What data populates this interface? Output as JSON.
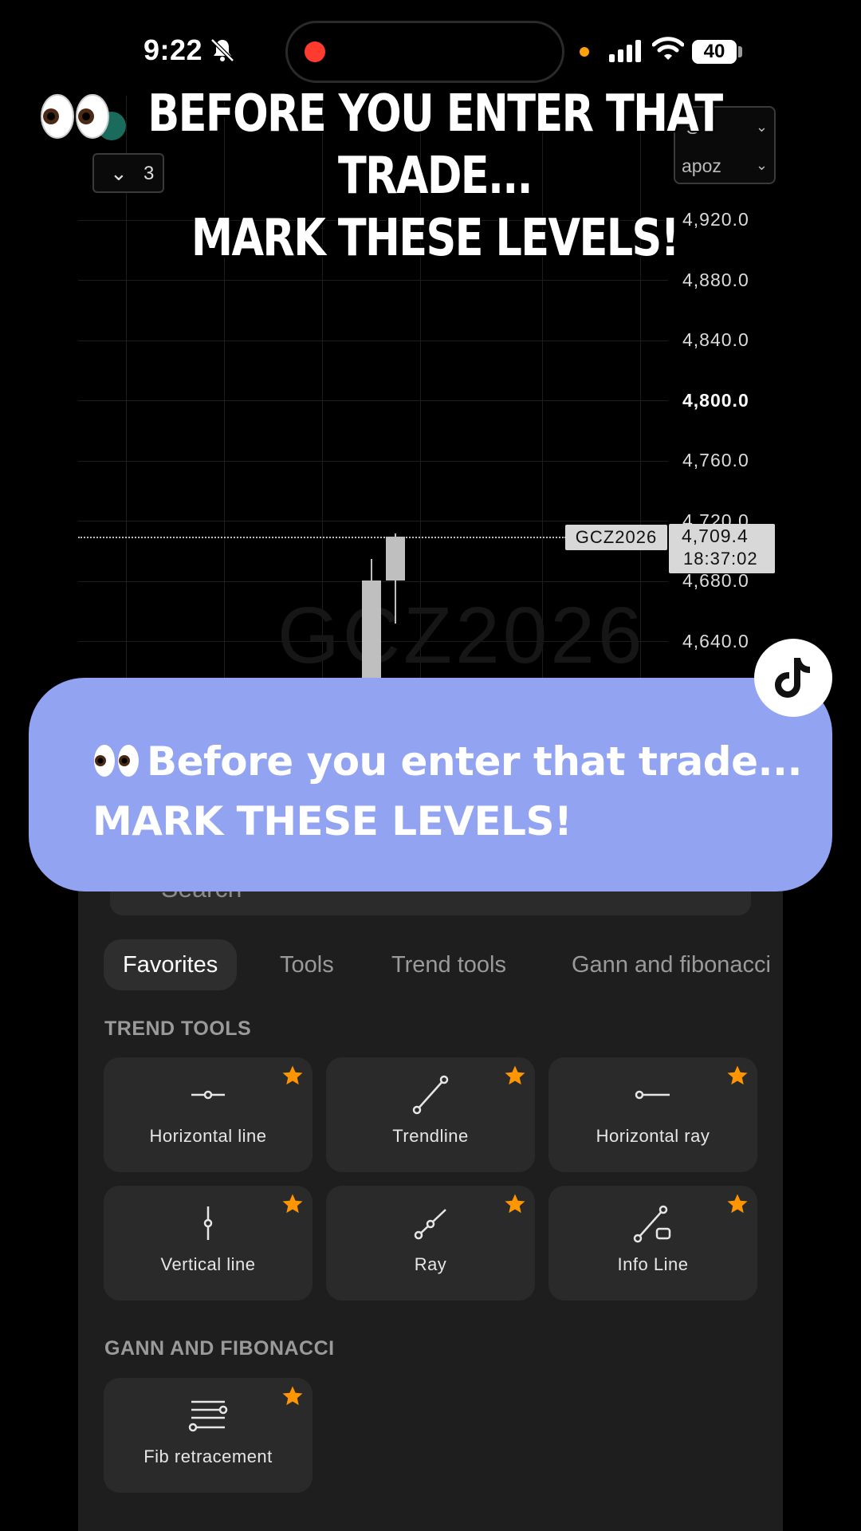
{
  "status_bar": {
    "time": "9:22",
    "battery": "40"
  },
  "overlay": {
    "line1": "BEFORE YOU ENTER THAT TRADE...",
    "line2": "MARK THESE LEVELS!"
  },
  "chart": {
    "collapse_count": "3",
    "dropdown_top": "S",
    "dropdown_bottom": "apoz",
    "symbol": "GCZ2026",
    "watermark": "GCZ2026",
    "last_price": "4,709.4",
    "countdown": "18:37:02",
    "y_ticks": [
      "4,920.0",
      "4,880.0",
      "4,840.0",
      "4,800.0",
      "4,760.0",
      "4,720.0",
      "4,680.0",
      "4,640.0"
    ]
  },
  "chart_data": {
    "type": "candlestick",
    "symbol": "GCZ2026",
    "ylim": [
      4620,
      4940
    ],
    "y_ticks": [
      4920,
      4880,
      4840,
      4800,
      4760,
      4720,
      4680,
      4640
    ],
    "last_price": 4709.4,
    "candles": [
      {
        "open": 4612,
        "high": 4695,
        "low": 4600,
        "close": 4681
      },
      {
        "open": 4681,
        "high": 4712,
        "low": 4652,
        "close": 4710
      }
    ]
  },
  "sheet": {
    "search_placeholder": "Search",
    "tabs": [
      "Favorites",
      "Tools",
      "Trend tools",
      "Gann and fibonacci"
    ],
    "sections": [
      {
        "title": "TREND TOOLS",
        "tools": [
          "Horizontal line",
          "Trendline",
          "Horizontal ray",
          "Vertical line",
          "Ray",
          "Info Line"
        ]
      },
      {
        "title": "GANN AND FIBONACCI",
        "tools": [
          "Fib retracement"
        ]
      }
    ]
  },
  "caption": {
    "line1": "Before you enter that trade...",
    "line2": "MARK THESE LEVELS!"
  },
  "colors": {
    "accent_star": "#ff9500",
    "bubble": "#92a3f2",
    "recording_dot": "#ff3b30"
  }
}
